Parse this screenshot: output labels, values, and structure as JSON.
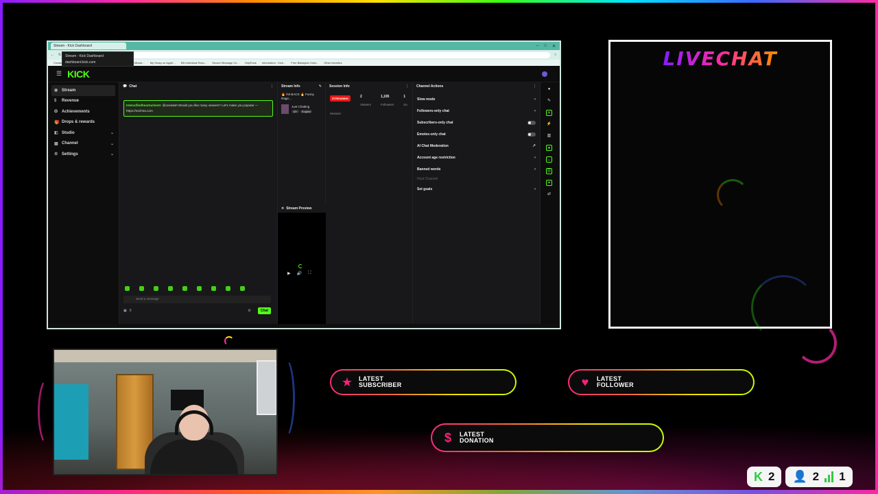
{
  "browser": {
    "tab_title": "Stream - Kick Dashboard",
    "tooltip_title": "Stream - Kick Dashboard",
    "tooltip_url": "dashboard.kick.com",
    "bookmarks": [
      "Creator Dashboard |...",
      "Monkey Video Chat...",
      "Free Robux Followe...",
      "My Scrap on Apple...",
      "Elit Individual Resu...",
      "Secure Message Ce...",
      "OnlyFans",
      "Information - Kick...",
      "Free Blackjack Onlin...",
      "Other favorites"
    ]
  },
  "kick": {
    "logo": "KICK",
    "sidebar": [
      {
        "label": "Stream",
        "active": true,
        "chevron": false
      },
      {
        "label": "Revenue",
        "chevron": false
      },
      {
        "label": "Achievements",
        "chevron": false
      },
      {
        "label": "Drops & rewards",
        "chevron": false
      },
      {
        "label": "Studio",
        "chevron": true
      },
      {
        "label": "Channel",
        "chevron": true
      },
      {
        "label": "Settings",
        "chevron": true
      }
    ],
    "chat": {
      "header": "Chat",
      "message_user": "Intensifiedheartaches0:",
      "message_text": "@onedash Would you like many viewers? Let's make you popular — https://nezhna.com",
      "input_placeholder": "Send a message",
      "count": "0",
      "send_label": "Chat"
    },
    "stream_info": {
      "header": "Stream Info",
      "title": "🔥 I'M BACK 🔥 Funny Rage...",
      "category": "Just Chatting",
      "tags": [
        "18+",
        "English"
      ]
    },
    "preview": {
      "header": "Stream Preview"
    },
    "session": {
      "header": "Session Info",
      "status": "STREAMING",
      "label": "Session",
      "stats": [
        {
          "value": "2",
          "label": "Viewers"
        },
        {
          "value": "1,195",
          "label": "Followers"
        },
        {
          "value": "1",
          "label": "Su"
        }
      ]
    },
    "actions": {
      "header": "Channel Actions",
      "items": [
        {
          "label": "Slow mode",
          "type": "arrow"
        },
        {
          "label": "Followers-only chat",
          "type": "arrow"
        },
        {
          "label": "Subscribers-only chat",
          "type": "toggle"
        },
        {
          "label": "Emotes-only chat",
          "type": "toggle"
        },
        {
          "label": "AI Chat Moderation",
          "type": "ext"
        },
        {
          "label": "Account age restriction",
          "type": "arrow"
        },
        {
          "label": "Banned words",
          "type": "arrow"
        },
        {
          "label": "Host Channel",
          "type": "dim"
        },
        {
          "label": "Set goals",
          "type": "arrow"
        }
      ]
    }
  },
  "overlay": {
    "livechat_title": "LIVECHAT",
    "alerts": {
      "subscriber": {
        "line1": "LATEST",
        "line2": "SUBSCRIBER"
      },
      "follower": {
        "line1": "LATEST",
        "line2": "FOLLOWER"
      },
      "donation": {
        "line1": "LATEST",
        "line2": "DONATION"
      }
    },
    "counters": {
      "kick_viewers": "2",
      "followers": "2",
      "bars": "1"
    },
    "colors": {
      "accent_green": "#53fc18",
      "alert_pink": "#ff1f7a",
      "live_red": "#e91916"
    }
  }
}
